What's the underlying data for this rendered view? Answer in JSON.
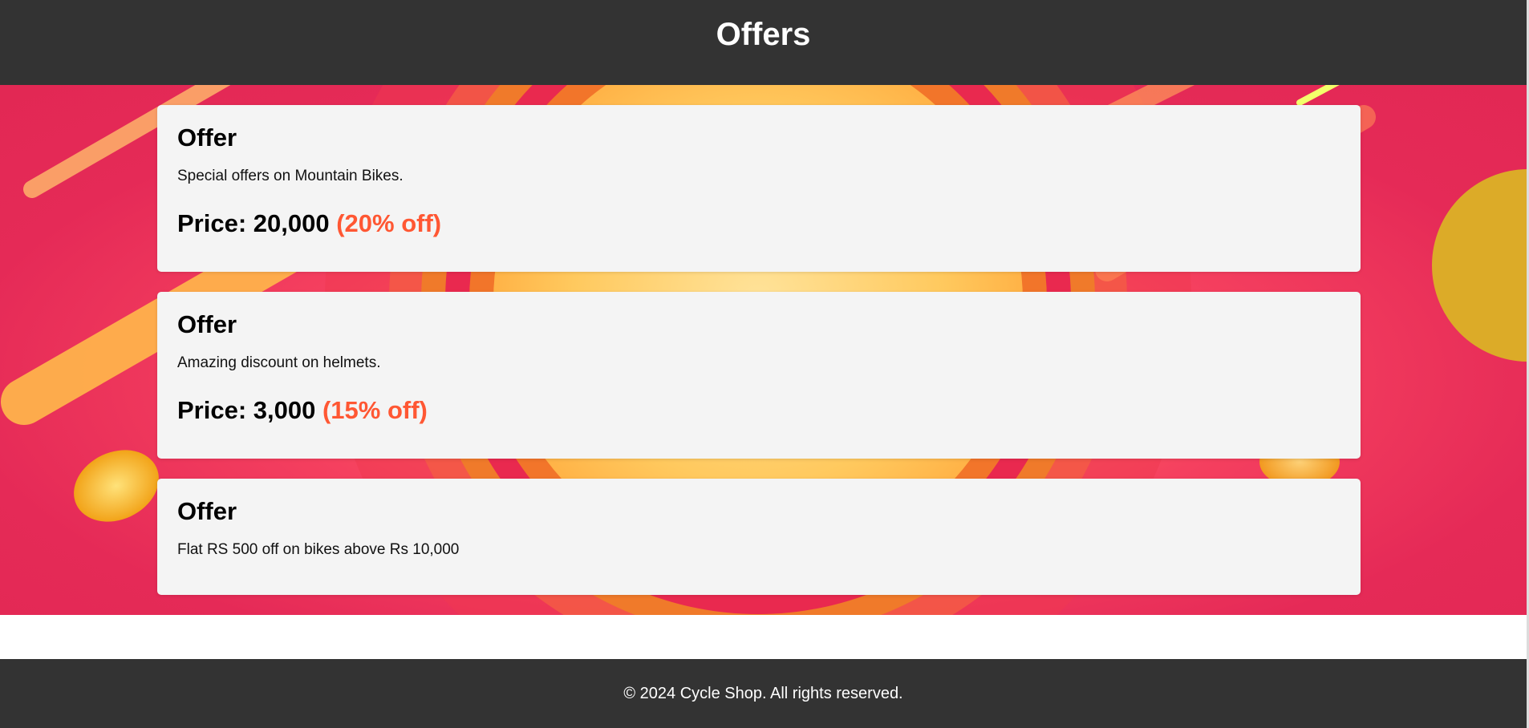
{
  "header": {
    "title": "Offers"
  },
  "offers": [
    {
      "title": "Offer",
      "description": "Special offers on Mountain Bikes.",
      "price_label": "Price: 20,000",
      "discount": "(20% off)"
    },
    {
      "title": "Offer",
      "description": "Amazing discount on helmets.",
      "price_label": "Price: 3,000",
      "discount": "(15% off)"
    },
    {
      "title": "Offer",
      "description": "Flat RS 500 off on bikes above Rs 10,000"
    }
  ],
  "footer": {
    "text": "© 2024 Cycle Shop. All rights reserved."
  },
  "colors": {
    "header_bg": "#333333",
    "discount": "#ff5733",
    "card_bg": "#f4f4f4",
    "hero_bg": "#e52a57"
  }
}
